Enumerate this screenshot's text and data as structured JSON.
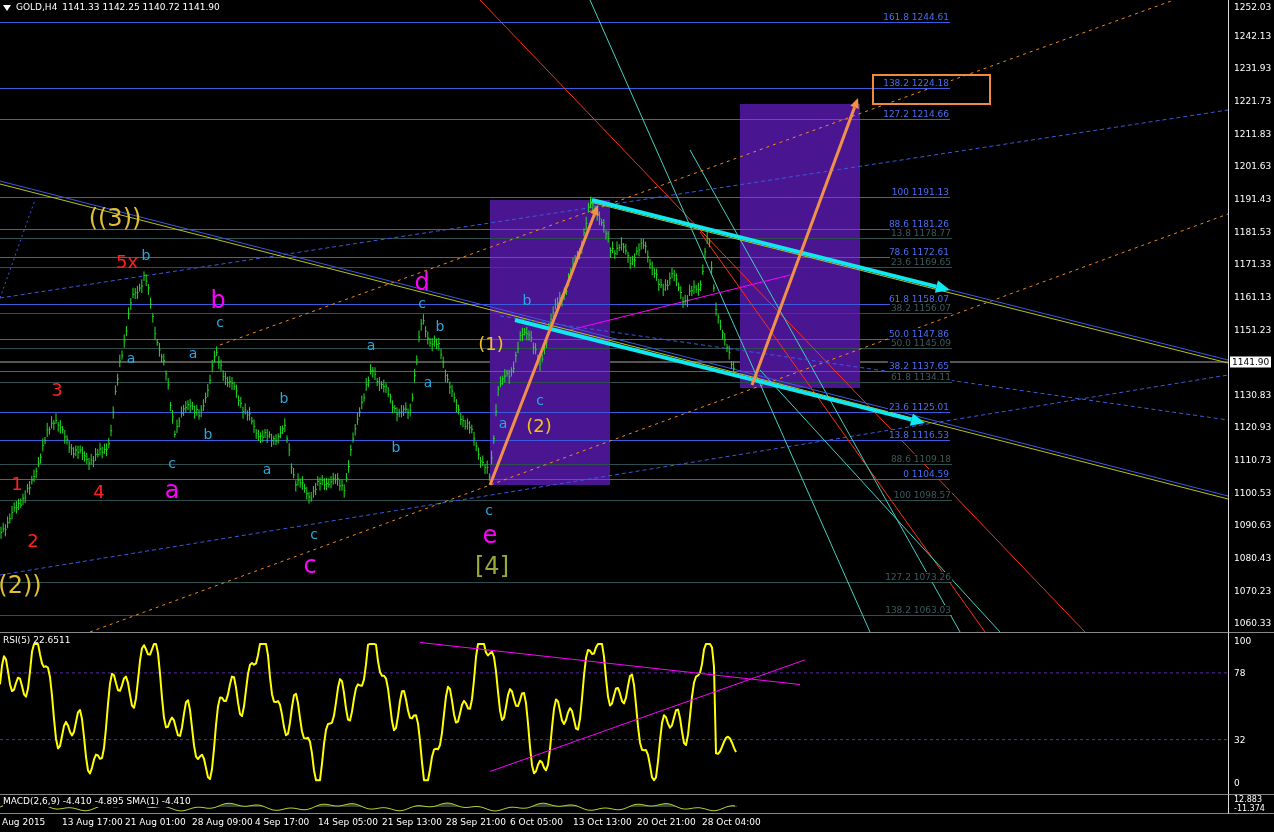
{
  "header": {
    "symbol": "GOLD,H4",
    "quotes": "1141.33 1142.25 1140.72 1141.90"
  },
  "price_axis": {
    "ticks": [
      "1252.03",
      "1242.13",
      "1231.93",
      "1221.73",
      "1211.83",
      "1201.63",
      "1191.43",
      "1181.53",
      "1171.33",
      "1161.13",
      "1151.23",
      "1130.83",
      "1120.93",
      "1110.73",
      "1100.53",
      "1090.63",
      "1080.43",
      "1070.23",
      "1060.33"
    ],
    "current": "1141.90"
  },
  "fib_levels": [
    {
      "text": "161.8 1244.61",
      "kind": "primary"
    },
    {
      "text": "138.2 1224.18",
      "kind": "primary"
    },
    {
      "text": "127.2 1214.66",
      "kind": "primary"
    },
    {
      "text": "100 1191.13",
      "kind": "primary"
    },
    {
      "text": "88.6 1181.26",
      "kind": "primary"
    },
    {
      "text": "13.8 1178.77",
      "kind": "secondary"
    },
    {
      "text": "78.6 1172.61",
      "kind": "primary"
    },
    {
      "text": "23.6 1169.65",
      "kind": "secondary"
    },
    {
      "text": "61.8 1158.07",
      "kind": "primary"
    },
    {
      "text": "38.2 1156.07",
      "kind": "secondary"
    },
    {
      "text": "50.0 1147.86",
      "kind": "primary"
    },
    {
      "text": "50.0 1145.09",
      "kind": "secondary"
    },
    {
      "text": "38.2 1137.65",
      "kind": "primary"
    },
    {
      "text": "61.8 1134.11",
      "kind": "secondary"
    },
    {
      "text": "23.6 1125.01",
      "kind": "primary"
    },
    {
      "text": "13.8 1116.53",
      "kind": "primary"
    },
    {
      "text": "88.6 1109.18",
      "kind": "secondary"
    },
    {
      "text": "0 1104.59",
      "kind": "primary"
    },
    {
      "text": "100 1098.57",
      "kind": "secondary"
    },
    {
      "text": "127.2 1073.26",
      "kind": "secondary"
    },
    {
      "text": "138.2 1063.03",
      "kind": "secondary"
    }
  ],
  "wave_labels": [
    {
      "text": "((3))",
      "color": "#e0c030",
      "kind": "large"
    },
    {
      "text": "5x",
      "color": "#ff2020",
      "kind": "medium"
    },
    {
      "text": "b",
      "color": "#29a9e0",
      "kind": "small"
    },
    {
      "text": "b",
      "color": "#ff00ff",
      "kind": "large"
    },
    {
      "text": "c",
      "color": "#29a9e0",
      "kind": "small"
    },
    {
      "text": "a",
      "color": "#29a9e0",
      "kind": "small"
    },
    {
      "text": "a",
      "color": "#29a9e0",
      "kind": "small"
    },
    {
      "text": "b",
      "color": "#29a9e0",
      "kind": "small"
    },
    {
      "text": "c",
      "color": "#29a9e0",
      "kind": "small"
    },
    {
      "text": "a",
      "color": "#ff00ff",
      "kind": "large"
    },
    {
      "text": "3",
      "color": "#ff2020",
      "kind": "medium"
    },
    {
      "text": "1",
      "color": "#ff2020",
      "kind": "medium"
    },
    {
      "text": "4",
      "color": "#ff2020",
      "kind": "medium"
    },
    {
      "text": "2",
      "color": "#ff2020",
      "kind": "medium"
    },
    {
      "text": "(2))",
      "color": "#e0c030",
      "kind": "large"
    },
    {
      "text": "b",
      "color": "#29a9e0",
      "kind": "small"
    },
    {
      "text": "a",
      "color": "#29a9e0",
      "kind": "small"
    },
    {
      "text": "c",
      "color": "#29a9e0",
      "kind": "small"
    },
    {
      "text": "c",
      "color": "#ff00ff",
      "kind": "large"
    },
    {
      "text": "a",
      "color": "#29a9e0",
      "kind": "small"
    },
    {
      "text": "b",
      "color": "#29a9e0",
      "kind": "small"
    },
    {
      "text": "d",
      "color": "#ff00ff",
      "kind": "large"
    },
    {
      "text": "c",
      "color": "#29a9e0",
      "kind": "small"
    },
    {
      "text": "a",
      "color": "#29a9e0",
      "kind": "small"
    },
    {
      "text": "b",
      "color": "#29a9e0",
      "kind": "small"
    },
    {
      "text": "(1)",
      "color": "#f0c020",
      "kind": "medium"
    },
    {
      "text": "a",
      "color": "#29a9e0",
      "kind": "small"
    },
    {
      "text": "c",
      "color": "#29a9e0",
      "kind": "small"
    },
    {
      "text": "e",
      "color": "#ff00ff",
      "kind": "large"
    },
    {
      "text": "[4]",
      "color": "#9aa83a",
      "kind": "large"
    },
    {
      "text": "b",
      "color": "#29a9e0",
      "kind": "small"
    },
    {
      "text": "c",
      "color": "#29a9e0",
      "kind": "small"
    },
    {
      "text": "(2)",
      "color": "#f0c020",
      "kind": "medium"
    }
  ],
  "rsi": {
    "title": "RSI(5) 22.6511",
    "ticks": [
      "100",
      "78",
      "32",
      "0"
    ]
  },
  "macd": {
    "title": "MACD(2,6,9) -4.410 -4.895 SMA(1) -4.410",
    "ticks": [
      "12.883",
      "-11.374"
    ]
  },
  "time_axis": [
    "Aug 2015",
    "13 Aug 17:00",
    "21 Aug 01:00",
    "28 Aug 09:00",
    "4 Sep 17:00",
    "14 Sep 05:00",
    "21 Sep 13:00",
    "28 Sep 21:00",
    "6 Oct 05:00",
    "13 Oct 13:00",
    "20 Oct 21:00",
    "28 Oct 04:00"
  ]
}
